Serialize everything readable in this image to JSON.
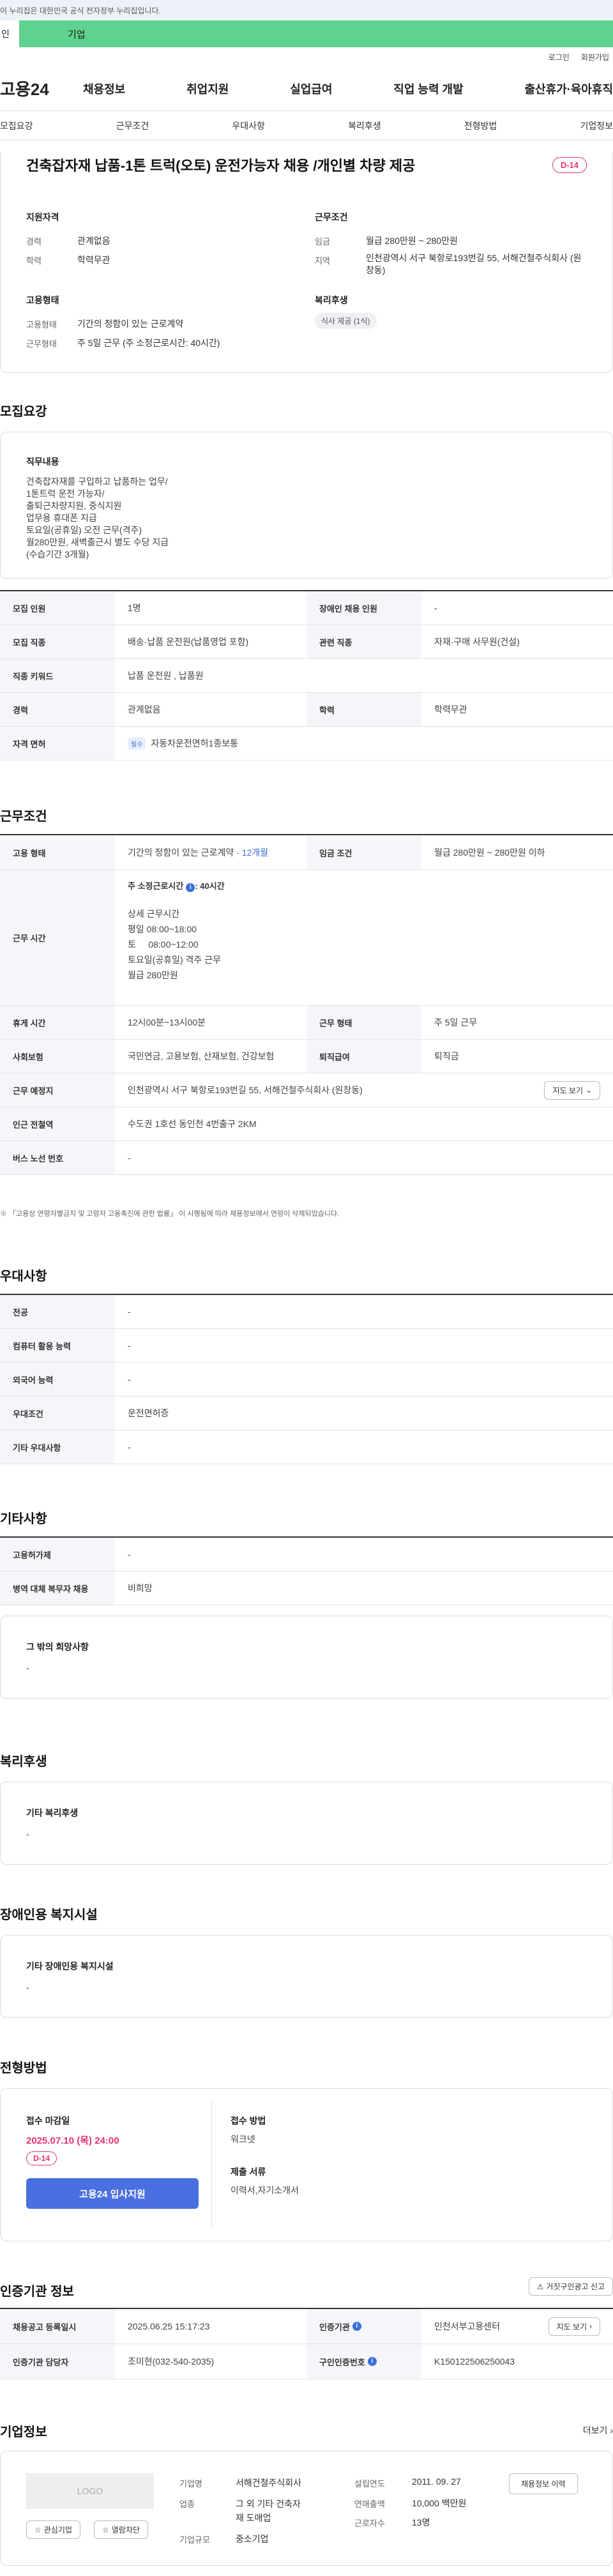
{
  "banner": {
    "text": "이 누리집은 대한민국 공식 전자정부 누리집입니다."
  },
  "usertabs": {
    "personal": "인",
    "company": "기업"
  },
  "utility": {
    "login": "로그인",
    "signup": "회원가입"
  },
  "gnb": {
    "logo": "고용24",
    "menu": [
      "채용정보",
      "취업지원",
      "실업급여",
      "직업 능력 개발",
      "출산휴가·육아휴직"
    ]
  },
  "subtabs": [
    "모집요강",
    "근무조건",
    "우대사항",
    "복리후생",
    "전형방법",
    "기업정보"
  ],
  "header": {
    "title": "건축잡자재 납품-1톤 트럭(오토) 운전가능자 채용 /개인별 차량 제공",
    "dday": "D-14",
    "qualification": {
      "heading": "지원자격",
      "career_label": "경력",
      "career": "관계없음",
      "edu_label": "학력",
      "edu": "학력무관"
    },
    "conditions": {
      "heading": "근무조건",
      "wage_label": "임금",
      "wage": "월급 280만원 ~ 280만원",
      "region_label": "지역",
      "region": "인천광역시 서구 북항로193번길 55, 서해건철주식회사 (원창동)"
    },
    "employment": {
      "heading": "고용형태",
      "type_label": "고용형태",
      "type": "기간의 정함이 있는 근로계약",
      "hours_label": "근무형태",
      "hours": "주 5일 근무 (주 소정근로시간: 40시간)"
    },
    "welfare": {
      "heading": "복리후생",
      "chip": "식사 제공 (1식)"
    }
  },
  "recruit": {
    "title": "모집요강",
    "duty_heading": "직무내용",
    "duty_text": "건축잡자재를 구입하고 납품하는 업무/\n1톤트럭 운전 가능자/\n출퇴근차량지원, 중식지원\n업무용 휴대폰 지급\n토요일(공휴일) 오전 근무(격주)\n월280만원, 새벽출근시 별도 수당 지급\n(수습기간 3개월)",
    "rows": [
      {
        "l1": "모집 인원",
        "v1": "1명",
        "l2": "장애인 채용 인원",
        "v2": "-"
      },
      {
        "l1": "모집 직종",
        "v1": "배송·납품 운전원(납품영업 포함)",
        "l2": "관련 직종",
        "v2": "자재·구매 사무원(건설)"
      },
      {
        "l1": "직종 키워드",
        "v1": "납품 운전원 , 납품원"
      },
      {
        "l1": "경력",
        "v1": "관계없음",
        "l2": "학력",
        "v2": "학력무관"
      },
      {
        "l1": "자격 면허",
        "badge": "필수",
        "v1": "자동차운전면허1종보통"
      }
    ]
  },
  "work": {
    "title": "근무조건",
    "type_label": "고용 형태",
    "type": "기간의 정함이 있는 근로계약 · ",
    "type_period": "12개월",
    "wage_label": "임금 조건",
    "wage": "월급 280만원 ~ 280만원 이하",
    "time_label": "근무 시간",
    "time_weekly": "주 소정근로시간",
    "time_weekly_val": ": 40시간",
    "time_detail": "상세 근무시간\n평일 08:00~18:00\n토     08:00~12:00\n토요일(공휴일) 격주 근무\n월급 280만원",
    "rest_label": "휴게 시간",
    "rest": "12시00분~13시00분",
    "shift_label": "근무 형태",
    "shift": "주 5일 근무",
    "insurance_label": "사회보험",
    "insurance": "국민연금, 고용보험, 산재보험, 건강보험",
    "retire_label": "퇴직급여",
    "retire": "퇴직금",
    "place_label": "근무 예정지",
    "place": "인천광역시 서구 북항로193번길 55, 서해건철주식회사 (원창동)",
    "map_btn": "지도 보기",
    "subway_label": "인근 전철역",
    "subway": "수도권 1호선 동인천 4번출구 2KM",
    "bus_label": "버스 노선 번호",
    "bus": "-",
    "note": "※ 「고용상 연령차별금지 및 고령자 고용촉진에 관한 법률」 이 시행됨에 따라 채용정보에서 연령이 삭제되었습니다."
  },
  "prefer": {
    "title": "우대사항",
    "rows": [
      {
        "l": "전공",
        "v": "-"
      },
      {
        "l": "컴퓨터 활용 능력",
        "v": "-"
      },
      {
        "l": "외국어 능력",
        "v": "-"
      },
      {
        "l": "우대조건",
        "v": "운전면허증"
      },
      {
        "l": "기타 우대사항",
        "v": "-"
      }
    ]
  },
  "etc": {
    "title": "기타사항",
    "rows": [
      {
        "l": "고용허가제",
        "v": "-"
      },
      {
        "l": "병역 대체 복무자 채용",
        "v": "비희망"
      }
    ],
    "box_heading": "그 밖의 희망사항",
    "box_text": "-"
  },
  "welfare": {
    "title": "복리후생",
    "box_heading": "기타 복리후생",
    "box_text": "-"
  },
  "disabled": {
    "title": "장애인용 복지시설",
    "box_heading": "기타 장애인용 복지시설",
    "box_text": "-"
  },
  "selection": {
    "title": "전형방법",
    "deadline_heading": "접수 마감일",
    "deadline": "2025.07.10 (목) 24:00",
    "dday": "D-14",
    "apply_btn": "고용24 입사지원",
    "method_heading": "접수 방법",
    "method": "워크넷",
    "docs_heading": "제출 서류",
    "docs": "이력서,자기소개서"
  },
  "cert": {
    "title": "인증기관 정보",
    "report_btn": "거짓구인광고 신고",
    "r1l1": "채용공고 등록일시",
    "r1v1": "2025.06.25 15:17:23",
    "r1l2": "인증기관",
    "r1v2": "인천서부고용센터",
    "map_btn": "지도 보기",
    "r2l1": "인증기관 담당자",
    "r2v1": "조미현(032-540-2035)",
    "r2l2": "구인인증번호",
    "r2v2": "K150122506250043"
  },
  "company": {
    "title": "기업정보",
    "more": "더보기",
    "logo": "LOGO",
    "fav_btn": "관심기업",
    "block_btn": "열람차단",
    "name_label": "기업명",
    "name": "서해건철주식회사",
    "industry_label": "업종",
    "industry": "그 외 기타 건축자\n재 도매업",
    "size_label": "기업규모",
    "size": "중소기업",
    "founded_label": "설립연도",
    "founded": "2011. 09. 27",
    "sales_label": "연매출액",
    "sales": "10,000 백만원",
    "staff_label": "근로자수",
    "staff": "13명",
    "jobs_btn": "채용정보 이력"
  }
}
